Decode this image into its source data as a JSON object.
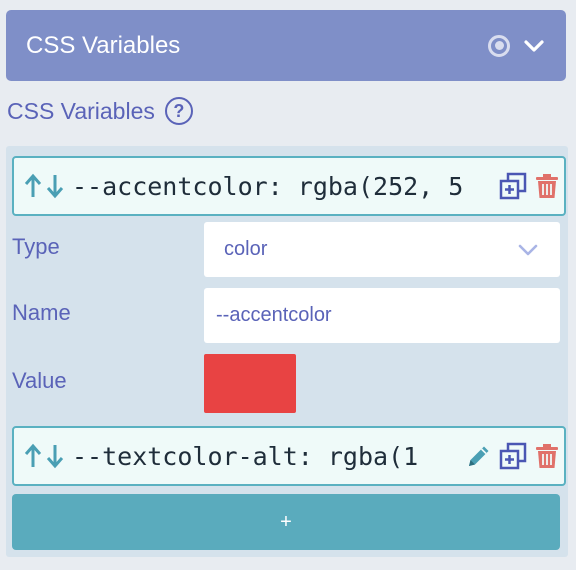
{
  "header": {
    "title": "CSS Variables",
    "radio_icon": "radio-selected-icon",
    "chevron_icon": "chevron-down-icon"
  },
  "section": {
    "title": "CSS Variables",
    "help_symbol": "?"
  },
  "variables": [
    {
      "display_text": "--accentcolor: rgba(252, 5",
      "icons": [
        "sort-arrows-icon",
        "duplicate-icon",
        "delete-icon"
      ]
    },
    {
      "display_text": "--textcolor-alt: rgba(1",
      "icons": [
        "sort-arrows-icon",
        "edit-pencil-icon",
        "duplicate-icon",
        "delete-icon"
      ]
    }
  ],
  "editor": {
    "type_label": "Type",
    "type_value": "color",
    "name_label": "Name",
    "name_value": "--accentcolor",
    "value_label": "Value",
    "value_color": "#e84343"
  },
  "add_button": {
    "label": "+"
  },
  "colors": {
    "header_bg": "#7f8fc8",
    "accent_text": "#5a63b8",
    "row_border": "#5ab1c1",
    "icon_blue": "#4a56b3",
    "icon_red": "#e0716a",
    "add_button_bg": "#5aabbd"
  }
}
